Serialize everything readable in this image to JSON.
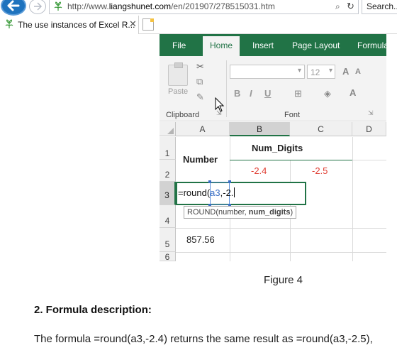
{
  "browser": {
    "url_prefix": "http://www.",
    "url_domain": "liangshunet.com",
    "url_path": "/en/201907/278515031.htm",
    "search_placeholder": "Search...",
    "tab_title": "The use instances of Excel R...",
    "tab_close": "✕"
  },
  "excel": {
    "ribbon_tabs": [
      "File",
      "Home",
      "Insert",
      "Page Layout",
      "Formula"
    ],
    "paste_label": "Paste",
    "clipboard_label": "Clipboard",
    "font_label": "Font",
    "font_size": "12",
    "format_buttons": [
      "B",
      "I",
      "U"
    ],
    "columns": [
      "A",
      "B",
      "C",
      "D"
    ],
    "rows": [
      "1",
      "2",
      "3",
      "4",
      "5",
      "6"
    ],
    "header_a": "Number",
    "header_bc": "Num_Digits",
    "b2": "-2.4",
    "c2": "-2.5",
    "formula_prefix": "=round(",
    "formula_ref": "a3",
    "formula_suffix": ",-2.",
    "tooltip_fn": "ROUND(number, ",
    "tooltip_arg": "num_digits",
    "tooltip_close": ")",
    "a5": "857.56",
    "accent": "#217346",
    "red": "#e03c31"
  },
  "article": {
    "caption": "Figure 4",
    "heading": "2. Formula description:",
    "body": "The formula =round(a3,-2.4) returns the same result as =round(a3,-2.5),"
  }
}
